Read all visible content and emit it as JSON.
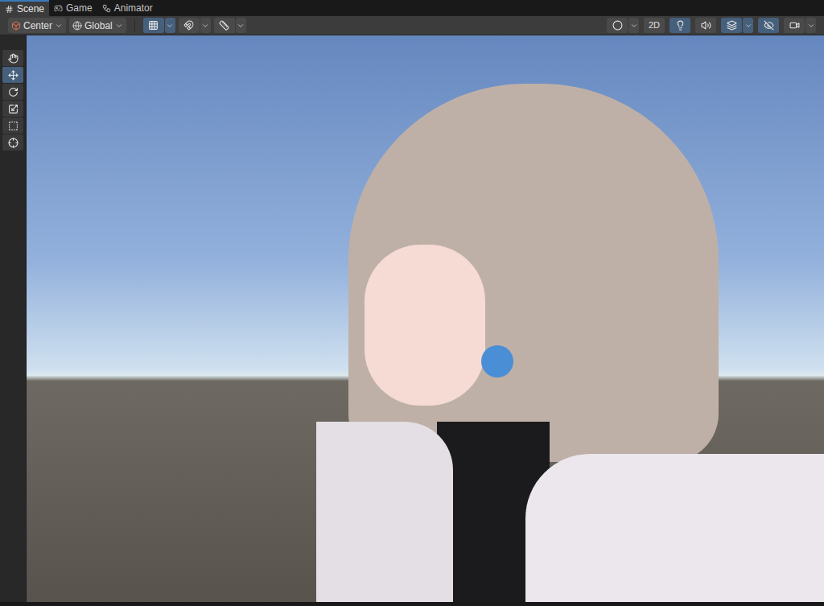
{
  "tabs": [
    {
      "label": "Scene",
      "selected": true,
      "kind": "scene"
    },
    {
      "label": "Game",
      "selected": false,
      "kind": "game"
    },
    {
      "label": "Animator",
      "selected": false,
      "kind": "animator"
    }
  ],
  "toolbar": {
    "pivot_mode": "Center",
    "pivot_rotation": "Global",
    "left_buttons": [
      {
        "kind": "grid",
        "on": true
      },
      {
        "kind": "snap",
        "on": false
      },
      {
        "kind": "increment",
        "on": false
      }
    ],
    "right_buttons": [
      {
        "kind": "shading",
        "on": false
      },
      {
        "kind": "mode2d",
        "label": "2D",
        "on": false
      },
      {
        "kind": "lighting",
        "on": true
      },
      {
        "kind": "audio",
        "on": false
      },
      {
        "kind": "effects",
        "on": true
      },
      {
        "kind": "hidden",
        "on": true
      },
      {
        "kind": "camera",
        "on": false
      }
    ]
  },
  "tools": [
    {
      "kind": "view",
      "selected": false
    },
    {
      "kind": "move",
      "selected": true
    },
    {
      "kind": "rotate",
      "selected": false
    },
    {
      "kind": "scale",
      "selected": false
    },
    {
      "kind": "rect",
      "selected": false
    },
    {
      "kind": "transform",
      "selected": false
    }
  ]
}
